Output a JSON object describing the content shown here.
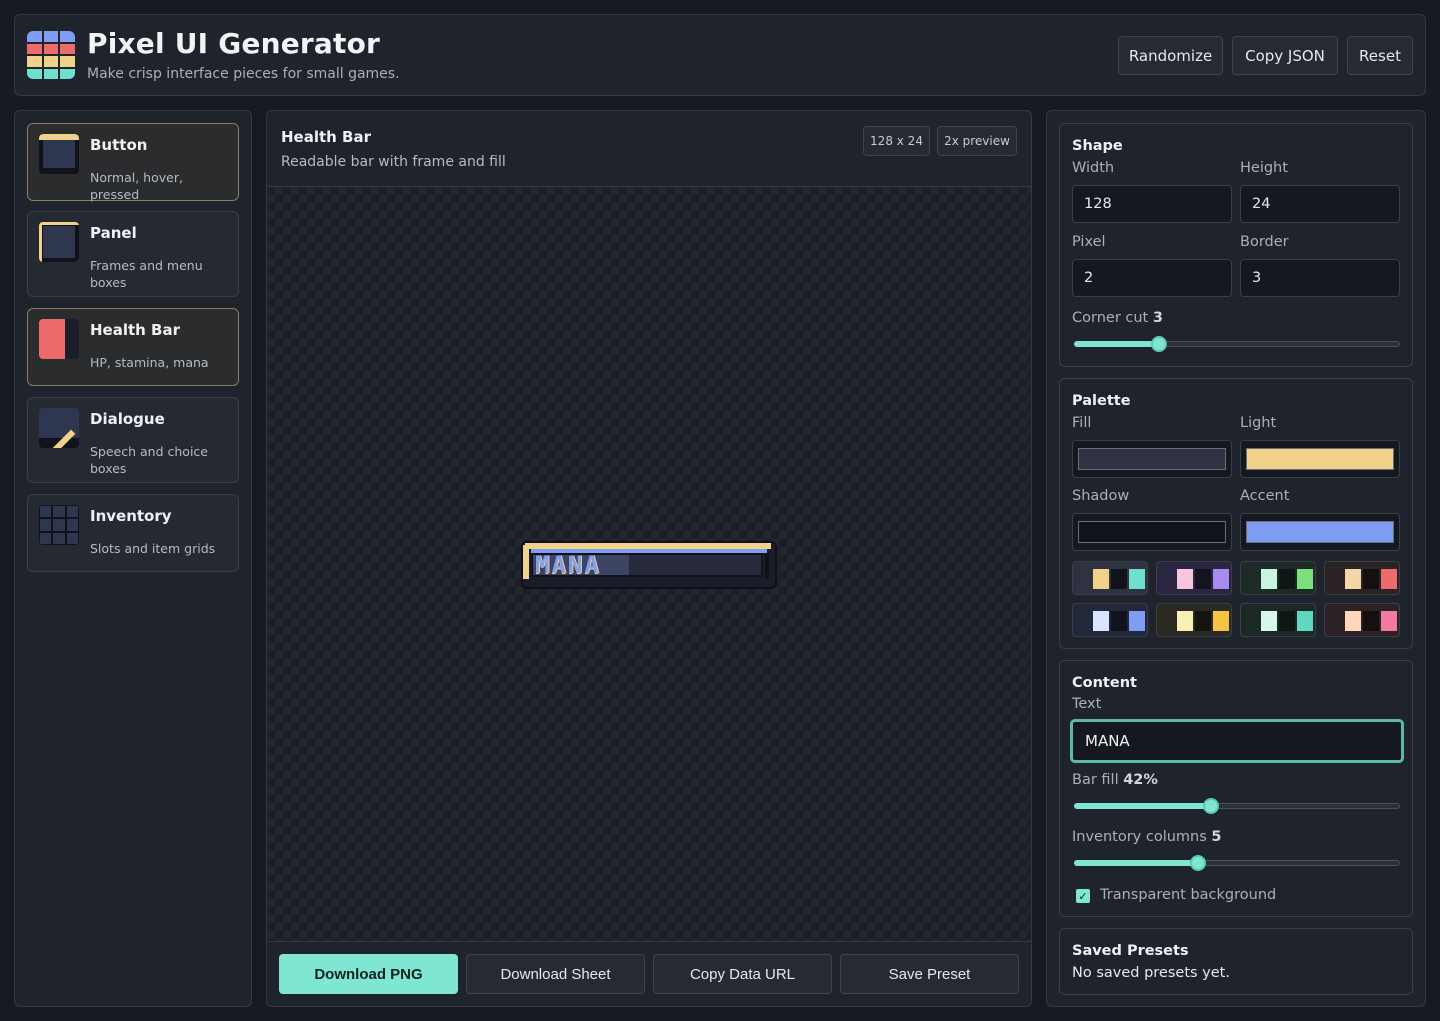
{
  "header": {
    "title": "Pixel UI Generator",
    "subtitle": "Make crisp interface pieces for small games.",
    "actions": [
      "Randomize",
      "Copy JSON",
      "Reset"
    ]
  },
  "components": [
    {
      "name": "Button",
      "desc": "Normal, hover, pressed",
      "active": true
    },
    {
      "name": "Panel",
      "desc": "Frames and menu boxes",
      "active": false
    },
    {
      "name": "Health Bar",
      "desc": "HP, stamina, mana",
      "active": true
    },
    {
      "name": "Dialogue",
      "desc": "Speech and choice boxes",
      "active": false
    },
    {
      "name": "Inventory",
      "desc": "Slots and item grids",
      "active": false
    }
  ],
  "canvas": {
    "title": "Health Bar",
    "description": "Readable bar with frame and fill",
    "size_chip": "128 x 24",
    "preview_chip": "2x preview",
    "preview_text": "MANA",
    "bar_fill": 0.42
  },
  "downloads": [
    "Download PNG",
    "Download Sheet",
    "Copy Data URL",
    "Save Preset"
  ],
  "shape": {
    "title": "Shape",
    "width_label": "Width",
    "width": "128",
    "height_label": "Height",
    "height": "24",
    "pixel_label": "Pixel",
    "pixel": "2",
    "border_label": "Border",
    "border": "3",
    "corner_label": "Corner cut",
    "corner": "3",
    "corner_fraction": 0.26
  },
  "palette": {
    "title": "Palette",
    "fill_label": "Fill",
    "fill": "#2f3241",
    "light_label": "Light",
    "light": "#f0d28a",
    "shadow_label": "Shadow",
    "shadow": "#11131a",
    "accent_label": "Accent",
    "accent": "#7f9df3",
    "presets": [
      [
        "#2f3241",
        "#f0d28a",
        "#11131a",
        "#6fe0cf"
      ],
      [
        "#2a2540",
        "#f7c6dd",
        "#151320",
        "#a98af0"
      ],
      [
        "#1d2a28",
        "#c9f5df",
        "#0f1614",
        "#7ee07a"
      ],
      [
        "#2a2224",
        "#f6d6a6",
        "#140f10",
        "#ee6b6b"
      ],
      [
        "#22283a",
        "#dbe4ff",
        "#111420",
        "#7f9df3"
      ],
      [
        "#2a2a22",
        "#fbf0b3",
        "#14140f",
        "#f5c442"
      ],
      [
        "#1c2826",
        "#d8f7ea",
        "#0e1513",
        "#5fd8bf"
      ],
      [
        "#2c2226",
        "#ffd7b8",
        "#150f12",
        "#f27aa0"
      ]
    ]
  },
  "content": {
    "title": "Content",
    "text_label": "Text",
    "text": "MANA",
    "bar_fill_label": "Bar fill",
    "bar_fill_value": "42%",
    "bar_fill_fraction": 0.42,
    "inv_label": "Inventory columns",
    "inv_value": "5",
    "inv_fraction": 0.38,
    "transparent_label": "Transparent background",
    "transparent": true
  },
  "saved": {
    "title": "Saved Presets",
    "empty": "No saved presets yet."
  },
  "colors": {
    "accent": "#7fe6d1",
    "logo": [
      "#7f9df3",
      "#ee6b6b",
      "#f0d28a",
      "#6fe0cf"
    ]
  }
}
